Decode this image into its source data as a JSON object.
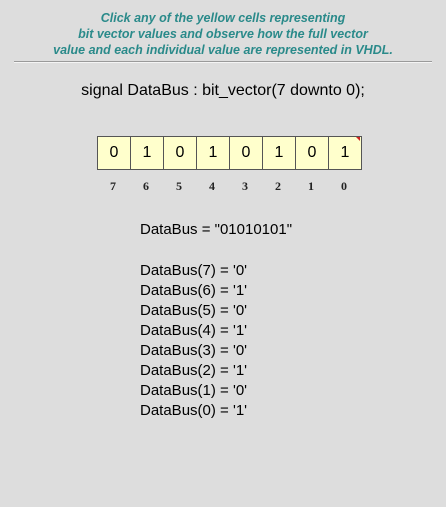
{
  "instructions": [
    "Click any of the yellow cells representing",
    "bit vector values and observe how the full vector",
    "value and each individual value are represented in VHDL."
  ],
  "declaration": "signal DataBus : bit_vector(7 downto 0);",
  "cells": [
    "0",
    "1",
    "0",
    "1",
    "0",
    "1",
    "0",
    "1"
  ],
  "indices": [
    "7",
    "6",
    "5",
    "4",
    "3",
    "2",
    "1",
    "0"
  ],
  "vector_line": "DataBus = \"01010101\"",
  "bit_lines": [
    "DataBus(7) = '0'",
    "DataBus(6) = '1'",
    "DataBus(5) = '0'",
    "DataBus(4) = '1'",
    "DataBus(3) = '0'",
    "DataBus(2) = '1'",
    "DataBus(1) = '0'",
    "DataBus(0) = '1'"
  ],
  "colors": {
    "instruction_text": "#2a8a8a",
    "cell_fill": "#ffffcc",
    "background": "#dddddd",
    "marker": "#cc2222"
  }
}
